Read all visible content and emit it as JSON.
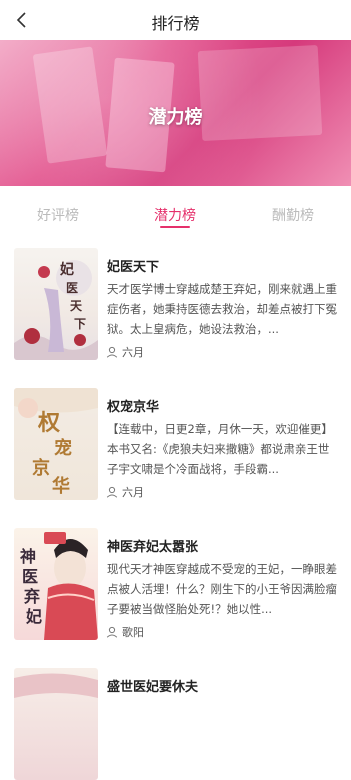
{
  "header": {
    "title": "排行榜"
  },
  "banner": {
    "label": "潜力榜"
  },
  "tabs": [
    {
      "label": "好评榜",
      "active": false
    },
    {
      "label": "潜力榜",
      "active": true
    },
    {
      "label": "酬勤榜",
      "active": false
    }
  ],
  "accent_color": "#e5306b",
  "books": [
    {
      "title": "妃医天下",
      "description": "天才医学博士穿越成楚王弃妃，刚来就遇上重症伤者，她秉持医德去救治，却差点被打下冤狱。太上皇病危，她设法救治，...",
      "author": "六月",
      "cover_text": "妃医天下"
    },
    {
      "title": "权宠京华",
      "description": "【连载中，日更2章，月休一天，欢迎催更】本书又名:《虎狼夫妇来撒糖》都说肃亲王世子宇文啸是个冷面战将，手段霸...",
      "author": "六月",
      "cover_text": "权宠京华"
    },
    {
      "title": "神医弃妃太嚣张",
      "description": "现代天才神医穿越成不受宠的王妃，一睁眼差点被人活埋！什么？刚生下的小王爷因满脸瘤子要被当做怪胎处死!？她以性...",
      "author": "歌阳",
      "cover_text": "神医弃妃"
    },
    {
      "title": "盛世医妃要休夫",
      "description": "",
      "author": "",
      "cover_text": ""
    }
  ]
}
